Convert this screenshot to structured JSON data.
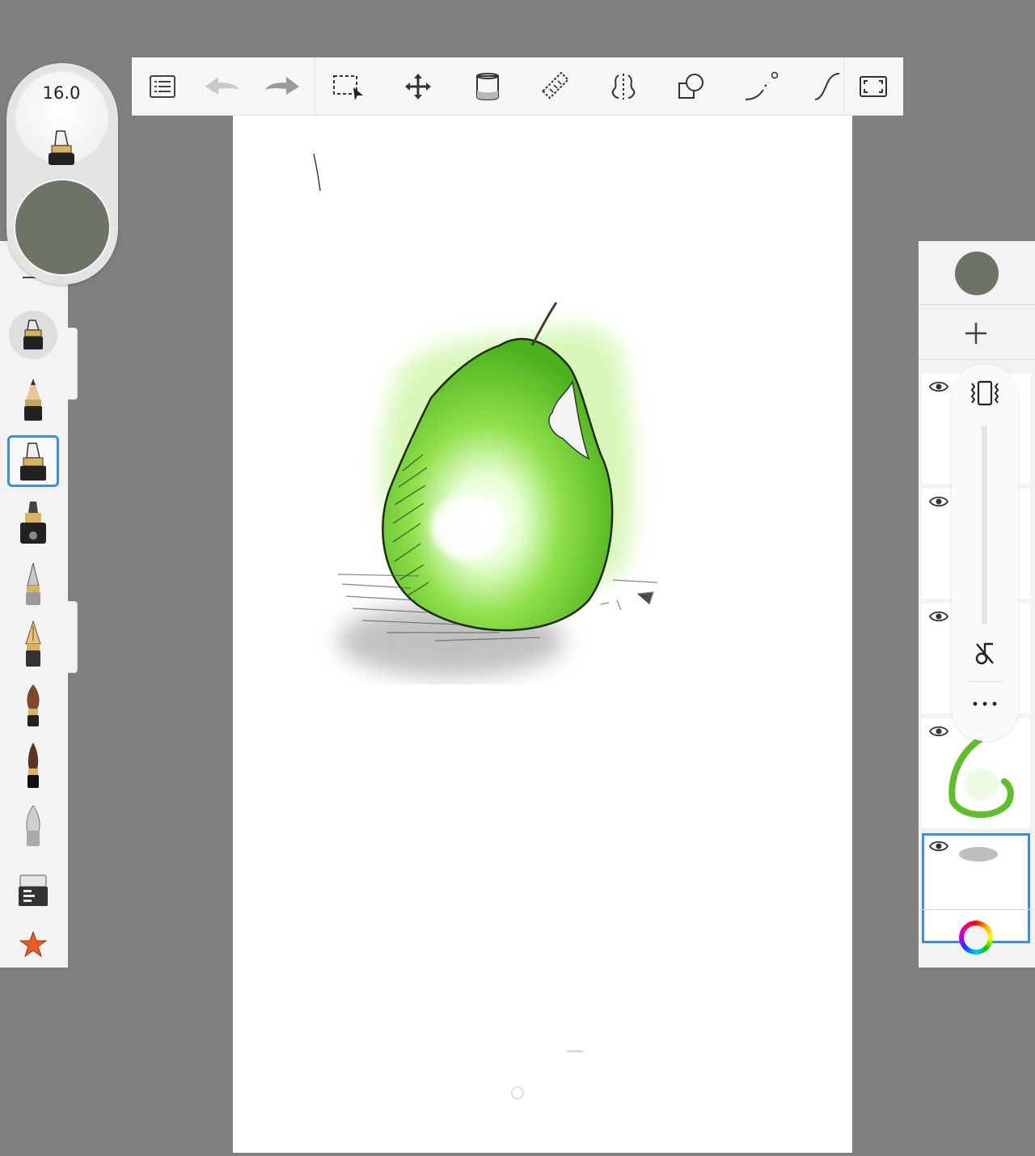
{
  "brush_puck": {
    "size_value": "16.0",
    "color": "#6b7467"
  },
  "toolbar": {
    "items": [
      {
        "name": "menu-list-icon"
      },
      {
        "name": "undo-icon"
      },
      {
        "name": "redo-icon"
      },
      {
        "name": "selection-icon"
      },
      {
        "name": "transform-move-icon"
      },
      {
        "name": "fill-bucket-icon"
      },
      {
        "name": "ruler-icon"
      },
      {
        "name": "symmetry-icon"
      },
      {
        "name": "shapes-icon"
      },
      {
        "name": "predictive-stroke-icon"
      },
      {
        "name": "stroke-curve-icon"
      },
      {
        "name": "fullscreen-icon"
      }
    ]
  },
  "brushes": [
    "marker-brush",
    "pencil-brush",
    "marker-brush-selected",
    "paint-brush",
    "airbrush",
    "fountain-pen",
    "round-brush",
    "ink-brush",
    "smudge-brush",
    "eraser",
    "favorites-star"
  ],
  "layers": {
    "current_color": "#6b7467",
    "count": 5,
    "selected_index": 4
  },
  "colors": {
    "accent": "#3a8ee6",
    "pear_green": "#7fd83a",
    "star": "#f05a22"
  }
}
